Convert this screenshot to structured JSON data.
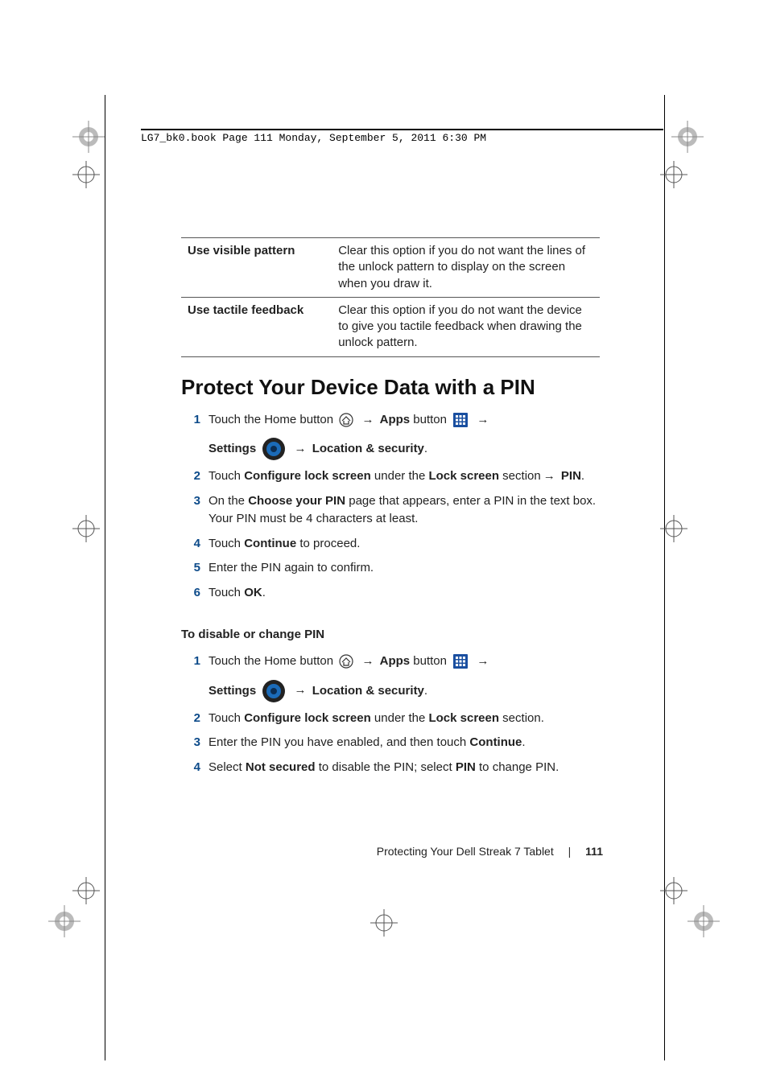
{
  "header_meta": "LG7_bk0.book  Page 111  Monday, September 5, 2011  6:30 PM",
  "table_rows": [
    {
      "label": "Use visible pattern",
      "desc": "Clear this option if you do not want the lines of the unlock pattern to display on the screen when you draw it."
    },
    {
      "label": "Use tactile feedback",
      "desc": "Clear this option if you do not want the device to give you tactile feedback when drawing the unlock pattern."
    }
  ],
  "section_title": "Protect Your Device Data with a PIN",
  "steps_a": {
    "s1": {
      "pre": "Touch the Home button ",
      "apps": "Apps",
      "mid": " button ",
      "settings": "Settings",
      "loc": "Location & security"
    },
    "s2": {
      "p1": "Touch ",
      "b1": "Configure lock screen",
      "p2": " under the ",
      "b2": "Lock screen",
      "p3": " section",
      "b3": "PIN",
      "p4": "."
    },
    "s3": {
      "p1": "On the ",
      "b1": "Choose your PIN",
      "p2": " page that appears, enter a PIN in the text box. Your PIN must be 4 characters at least."
    },
    "s4": {
      "p1": "Touch ",
      "b1": "Continue",
      "p2": " to proceed."
    },
    "s5": "Enter the PIN again to confirm.",
    "s6": {
      "p1": "Touch ",
      "b1": "OK",
      "p2": "."
    }
  },
  "subheading": "To disable or change PIN",
  "steps_b": {
    "s1": {
      "pre": "Touch the Home button ",
      "apps": "Apps",
      "mid": " button ",
      "settings": "Settings",
      "loc": "Location & security"
    },
    "s2": {
      "p1": "Touch ",
      "b1": "Configure lock screen",
      "p2": " under the ",
      "b2": "Lock screen",
      "p3": " section."
    },
    "s3": {
      "p1": "Enter the PIN you have enabled, and then touch ",
      "b1": "Continue",
      "p2": "."
    },
    "s4": {
      "p1": "Select ",
      "b1": "Not secured",
      "p2": " to disable the PIN; select ",
      "b2": "PIN",
      "p3": " to change PIN."
    }
  },
  "footer_title": "Protecting Your Dell Streak 7 Tablet",
  "page_number": "111",
  "arrow": "→"
}
